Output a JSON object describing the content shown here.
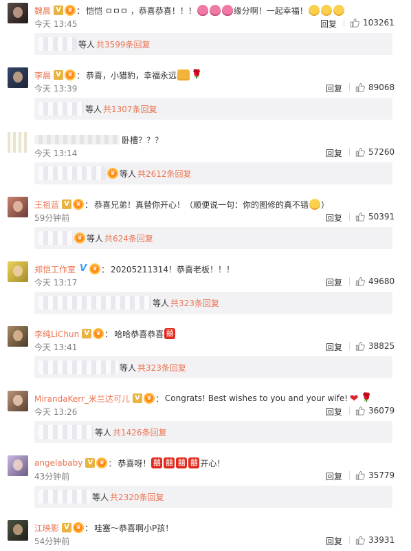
{
  "comments": [
    {
      "user": "魏晨",
      "verified": "gold",
      "medal": true,
      "text": "恺恺 ㅁㅁㅁ ，恭喜恭喜！！！",
      "emojis_after": [
        "heart",
        "heart",
        "heart"
      ],
      "text2": "缘分啊！一起幸福！",
      "emojis_end": [
        "happy",
        "happy",
        "happy"
      ],
      "time": "今天 13:45",
      "reply": "回复",
      "likes": "103261",
      "sub_deng": "等人",
      "sub_total": "共3599条回复"
    },
    {
      "user": "李晨",
      "verified": "gold",
      "medal": true,
      "text": "恭喜，小猎豹，幸福永远",
      "emojis_end": [
        "cheers",
        "rose"
      ],
      "time": "今天 13:39",
      "reply": "回复",
      "likes": "89068",
      "sub_deng": "等人",
      "sub_total": "共1307条回复"
    },
    {
      "user": "",
      "verified": "",
      "medal": false,
      "text": "卧槽？？？",
      "time": "今天 13:14",
      "reply": "回复",
      "likes": "57260",
      "sub_deng": "等人",
      "sub_total": "共2612条回复"
    },
    {
      "user": "王祖蓝",
      "verified": "gold",
      "medal": true,
      "text": "恭喜兄弟！真替你开心！（顺便说一句：你的图修的真不错",
      "emojis_end": [
        "happy"
      ],
      "text2": "）",
      "time": "59分钟前",
      "reply": "回复",
      "likes": "50391",
      "sub_deng": "等人",
      "sub_total": "共624条回复"
    },
    {
      "user": "郑恺工作室",
      "verified": "blue",
      "medal": true,
      "text": "20205211314！恭喜老板！！！",
      "time": "今天 13:17",
      "reply": "回复",
      "likes": "49680",
      "sub_deng": "等人",
      "sub_total": "共323条回复"
    },
    {
      "user": "李纯LiChun",
      "verified": "gold",
      "medal": true,
      "text": "哈哈恭喜恭喜",
      "emojis_end": [
        "double-happy"
      ],
      "time": "今天 13:41",
      "reply": "回复",
      "likes": "38825",
      "sub_deng": "等人",
      "sub_total": "共323条回复"
    },
    {
      "user": "MirandaKerr_米兰达可儿",
      "verified": "gold",
      "medal": true,
      "text": "Congrats!  Best wishes to you and your wife!",
      "emojis_end": [
        "red-heart",
        "rose"
      ],
      "time": "今天 13:26",
      "reply": "回复",
      "likes": "36079",
      "sub_deng": "等人",
      "sub_total": "共1426条回复"
    },
    {
      "user": "angelababy",
      "verified": "gold",
      "medal": true,
      "text": "恭喜呀！",
      "emojis_after": [
        "double-happy",
        "double-happy",
        "double-happy"
      ],
      "text2": " 开心！",
      "time": "43分钟前",
      "reply": "回复",
      "likes": "35779",
      "sub_deng": "等人",
      "sub_total": "共2320条回复"
    },
    {
      "user": "江映影",
      "verified": "gold",
      "medal": true,
      "text": "哇塞～恭喜啊小P孩！",
      "time": "54分钟前",
      "reply": "回复",
      "likes": "33931"
    }
  ],
  "icons": {
    "verified": "v-badge-icon",
    "medal": "fan-medal-icon",
    "like": "thumbs-up-icon"
  },
  "colors": {
    "username": "#eb7350",
    "total_link": "#eb7350",
    "meta": "#808080",
    "sub_bar_bg": "#f2f2f5"
  }
}
